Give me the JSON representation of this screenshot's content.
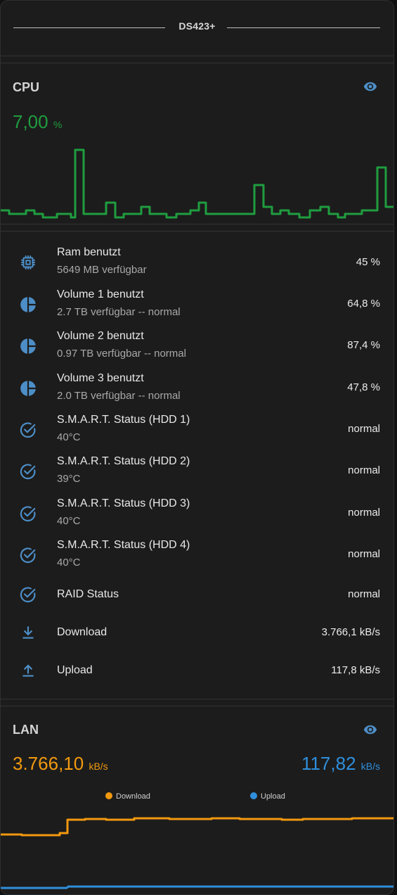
{
  "header": {
    "title": "DS423+"
  },
  "cpu": {
    "title": "CPU",
    "value": "7,00",
    "unit": "%",
    "value_color": "#1f9d3f",
    "icon": "eye-icon"
  },
  "metrics": [
    {
      "icon": "chip-icon",
      "name": "Ram benutzt",
      "sub": "5649 MB verfügbar",
      "value": "45 %"
    },
    {
      "icon": "pie-chart-icon",
      "name": "Volume 1 benutzt",
      "sub": "2.7 TB verfügbar -- normal",
      "value": "64,8 %"
    },
    {
      "icon": "pie-chart-icon",
      "name": "Volume 2 benutzt",
      "sub": "0.97 TB verfügbar -- normal",
      "value": "87,4 %"
    },
    {
      "icon": "pie-chart-icon",
      "name": "Volume 3 benutzt",
      "sub": "2.0 TB verfügbar -- normal",
      "value": "47,8 %"
    },
    {
      "icon": "check-circle-icon",
      "name": "S.M.A.R.T. Status (HDD 1)",
      "sub": "40°C",
      "value": "normal"
    },
    {
      "icon": "check-circle-icon",
      "name": "S.M.A.R.T. Status (HDD 2)",
      "sub": "39°C",
      "value": "normal"
    },
    {
      "icon": "check-circle-icon",
      "name": "S.M.A.R.T. Status (HDD 3)",
      "sub": "40°C",
      "value": "normal"
    },
    {
      "icon": "check-circle-icon",
      "name": "S.M.A.R.T. Status (HDD 4)",
      "sub": "40°C",
      "value": "normal"
    },
    {
      "icon": "check-circle-icon",
      "name": "RAID Status",
      "sub": "",
      "value": "normal"
    },
    {
      "icon": "download-icon",
      "name": "Download",
      "sub": "",
      "value": "3.766,1 kB/s"
    },
    {
      "icon": "upload-icon",
      "name": "Upload",
      "sub": "",
      "value": "117,8 kB/s"
    }
  ],
  "lan": {
    "title": "LAN",
    "icon": "eye-icon",
    "download_value": "3.766,10",
    "download_unit": "kB/s",
    "upload_value": "117,82",
    "upload_unit": "kB/s",
    "download_color": "#f2990f",
    "upload_color": "#2f8fdc",
    "legend_download": "Download",
    "legend_upload": "Upload"
  },
  "colors": {
    "accent": "#4d8ec7",
    "cpu_line": "#1f9d3f"
  }
}
